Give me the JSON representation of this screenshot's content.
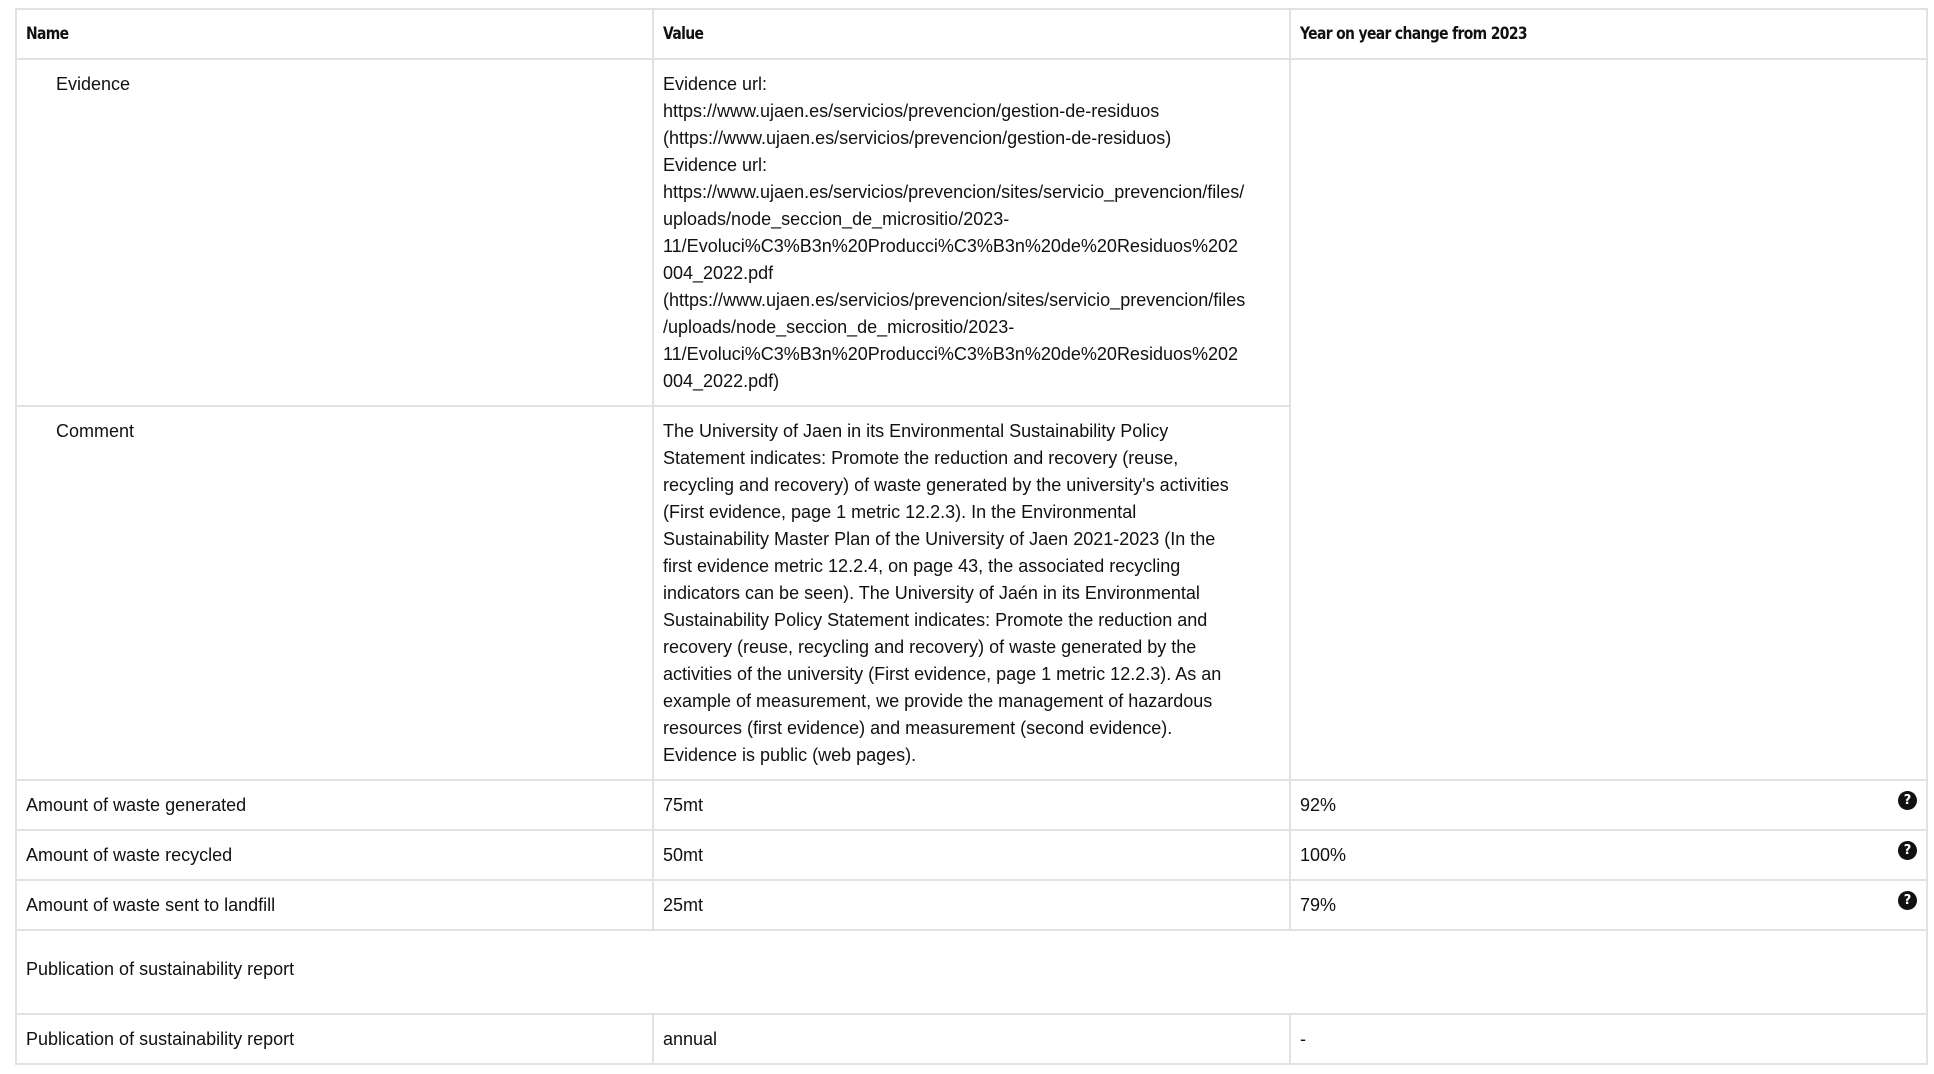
{
  "table": {
    "headers": {
      "name": "Name",
      "value": "Value",
      "yoy": "Year on year change from 2023"
    },
    "evidence": {
      "label": "Evidence",
      "lines": [
        "Evidence url:",
        "https://www.ujaen.es/servicios/prevencion/gestion-de-residuos",
        "(https://www.ujaen.es/servicios/prevencion/gestion-de-residuos)",
        "Evidence url:",
        "https://www.ujaen.es/servicios/prevencion/sites/servicio_prevencion/files/",
        "uploads/node_seccion_de_micrositio/2023-",
        "11/Evoluci%C3%B3n%20Producci%C3%B3n%20de%20Residuos%202",
        "004_2022.pdf",
        "(https://www.ujaen.es/servicios/prevencion/sites/servicio_prevencion/files",
        "/uploads/node_seccion_de_micrositio/2023-",
        "11/Evoluci%C3%B3n%20Producci%C3%B3n%20de%20Residuos%202",
        "004_2022.pdf)"
      ]
    },
    "comment": {
      "label": "Comment",
      "lines": [
        "The University of Jaen in its Environmental Sustainability Policy",
        "Statement indicates: Promote the reduction and recovery (reuse,",
        "recycling and recovery) of waste generated by the university's activities",
        "(First evidence, page 1 metric 12.2.3). In the Environmental",
        "Sustainability Master Plan of the University of Jaen 2021-2023 (In the",
        "first evidence metric 12.2.4, on page 43, the associated recycling",
        "indicators can be seen). The University of Jaén in its Environmental",
        "Sustainability Policy Statement indicates: Promote the reduction and",
        "recovery (reuse, recycling and recovery) of waste generated by the",
        "activities of the university (First evidence, page 1 metric 12.2.3). As an",
        "example of measurement, we provide the management of hazardous",
        "resources (first evidence) and measurement (second evidence).",
        "Evidence is public (web pages)."
      ]
    },
    "rows": [
      {
        "name": "Amount of waste generated",
        "value": "75mt",
        "yoy": "92%"
      },
      {
        "name": "Amount of waste recycled",
        "value": "50mt",
        "yoy": "100%"
      },
      {
        "name": "Amount of waste sent to landfill",
        "value": "25mt",
        "yoy": "79%"
      }
    ],
    "section_title": "Publication of sustainability report",
    "publication_row": {
      "name": "Publication of sustainability report",
      "value": "annual",
      "yoy": "-"
    },
    "help_icon_glyph": "?"
  }
}
